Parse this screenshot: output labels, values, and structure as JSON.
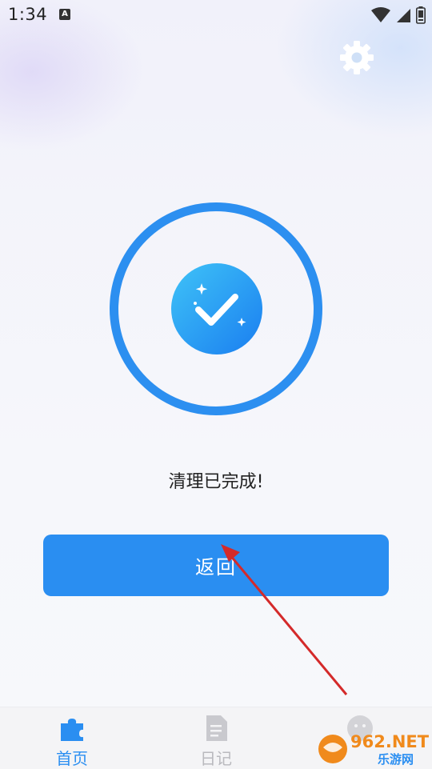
{
  "status_bar": {
    "time": "1:34",
    "badge": "A"
  },
  "icons": {
    "settings": "gear-icon",
    "success": "checkmark-circle-icon"
  },
  "result": {
    "message": "清理已完成!"
  },
  "actions": {
    "back_label": "返回"
  },
  "bottom_nav": {
    "items": [
      {
        "label": "首页",
        "icon": "puzzle-icon",
        "active": true
      },
      {
        "label": "日记",
        "icon": "document-icon",
        "active": false
      },
      {
        "label": "",
        "icon": "profile-icon",
        "active": false
      }
    ]
  },
  "watermark": {
    "brand": "962.NET",
    "sub": "乐游网"
  },
  "colors": {
    "accent": "#2a8ef1",
    "ring": "#2c8ff0",
    "nav_active": "#2a8ef1",
    "nav_inactive": "#b9b9be"
  }
}
